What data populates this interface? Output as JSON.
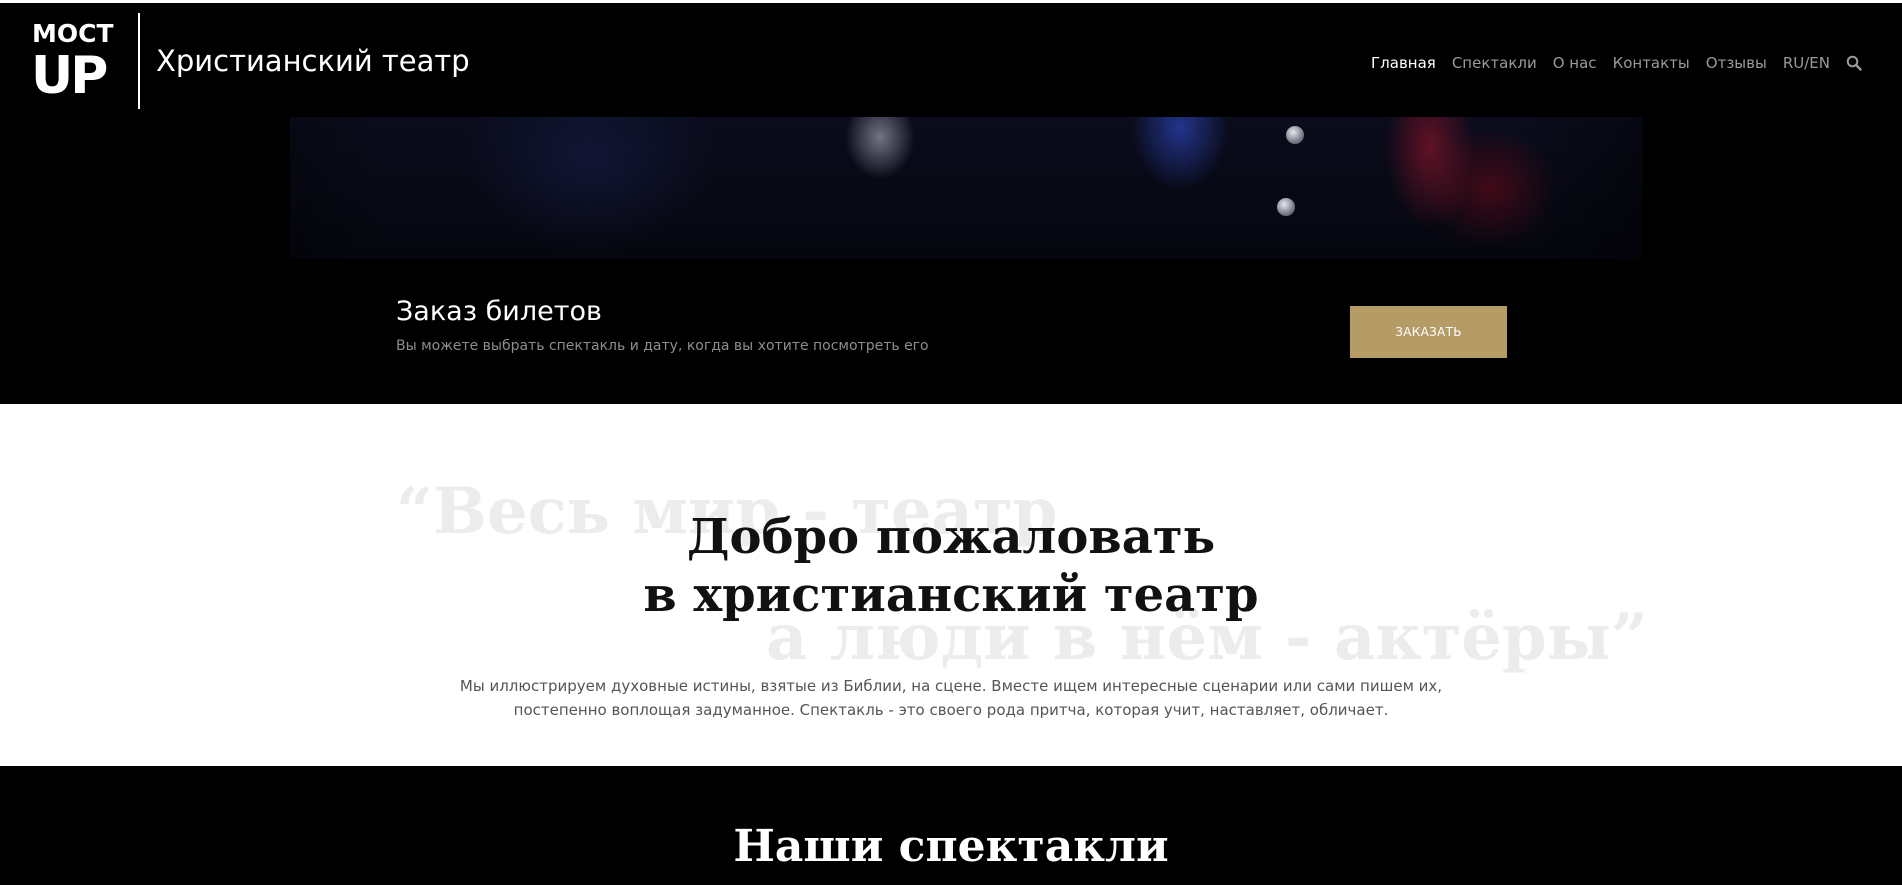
{
  "header": {
    "logo_top": "МОСТ",
    "logo_bottom": "UP",
    "site_title": "Христианский театр",
    "nav": [
      {
        "label": "Главная",
        "active": true
      },
      {
        "label": "Спектакли",
        "active": false
      },
      {
        "label": "О нас",
        "active": false
      },
      {
        "label": "Контакты",
        "active": false
      },
      {
        "label": "Отзывы",
        "active": false
      },
      {
        "label": "RU/EN",
        "active": false
      }
    ],
    "search_icon": "search-icon"
  },
  "tickets": {
    "title": "Заказ билетов",
    "subtitle": "Вы можете выбрать спектакль и дату, когда вы хотите посмотреть его",
    "button_label": "ЗАКАЗАТЬ"
  },
  "welcome": {
    "quote_line_1": "“Весь мир - театр",
    "quote_line_2": "а люди в нём - актёры”",
    "title_line_1": "Добро пожаловать",
    "title_line_2": "в христианский театр",
    "text": "Мы иллюстрируем духовные истины, взятые из Библии, на сцене. Вместе ищем интересные сценарии или сами пишем их, постепенно воплощая задуманное. Спектакль - это своего рода притча, которая учит, наставляет, обличает."
  },
  "performances": {
    "title": "Наши спектакли"
  },
  "colors": {
    "accent": "#b59b66",
    "background_dark": "#000000",
    "nav_inactive": "#9a9a9a"
  }
}
